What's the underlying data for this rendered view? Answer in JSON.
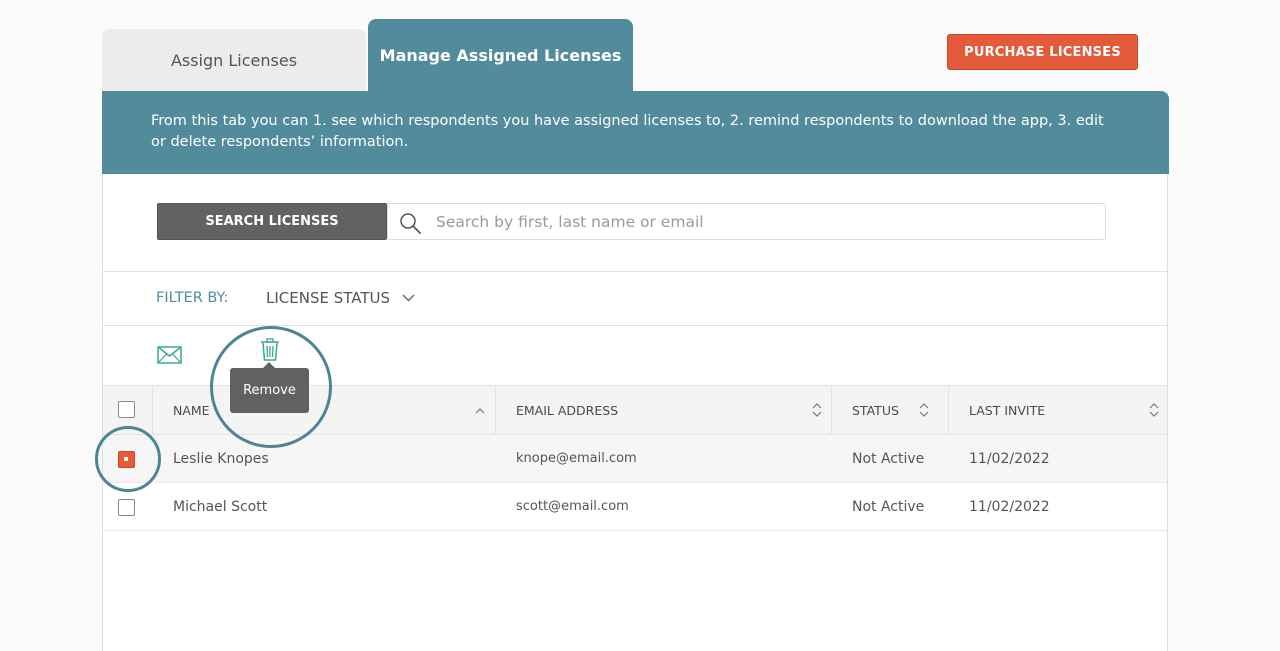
{
  "tabs": [
    {
      "label": "Assign Licenses",
      "active": false
    },
    {
      "label": "Manage Assigned Licenses",
      "active": true
    }
  ],
  "purchase_button": {
    "label": "PURCHASE LICENSES",
    "color": "#e55a3a"
  },
  "banner": {
    "text": "From this tab you can 1. see which respondents you have assigned licenses to, 2. remind respondents to download the app, 3. edit or delete respondents’ information.",
    "color": "#528c9c"
  },
  "search": {
    "button_label": "SEARCH LICENSES",
    "placeholder": "Search by first, last name or email",
    "value": "",
    "icon": "search-icon"
  },
  "filter": {
    "label": "FILTER BY:",
    "dropdown_label": "LICENSE STATUS"
  },
  "actions": {
    "email_icon": "mail-icon",
    "remove_icon": "trash-icon",
    "tooltip": "Remove"
  },
  "table": {
    "columns": [
      {
        "label": "NAME",
        "sort": "ascending"
      },
      {
        "label": "EMAIL ADDRESS",
        "sort": "none"
      },
      {
        "label": "STATUS",
        "sort": "none"
      },
      {
        "label": "LAST INVITE",
        "sort": "none"
      }
    ],
    "rows": [
      {
        "name": "Leslie Knopes",
        "email": "knope@email.com",
        "status": "Not Active",
        "last_invite": "11/02/2022",
        "selected": true
      },
      {
        "name": "Michael Scott",
        "email": "scott@email.com",
        "status": "Not Active",
        "last_invite": "11/02/2022",
        "selected": false
      }
    ]
  }
}
